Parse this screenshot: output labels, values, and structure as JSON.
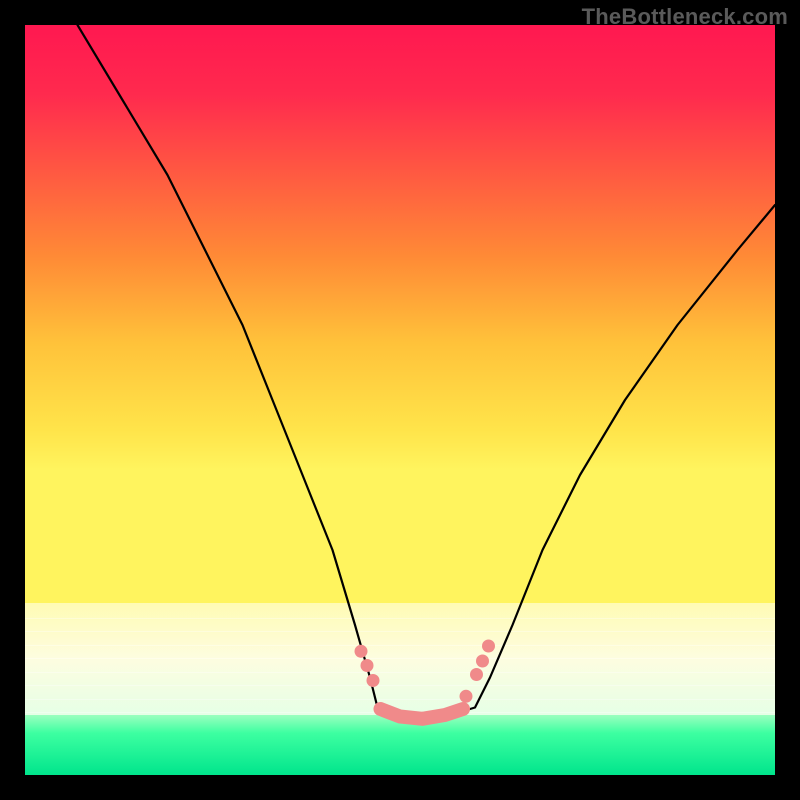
{
  "watermark": "TheBottleneck.com",
  "gradient": {
    "stops": [
      {
        "pos": 0.0,
        "color": "#ff1850"
      },
      {
        "pos": 0.12,
        "color": "#ff2a4e"
      },
      {
        "pos": 0.25,
        "color": "#ff5742"
      },
      {
        "pos": 0.4,
        "color": "#ff8a36"
      },
      {
        "pos": 0.55,
        "color": "#ffc23a"
      },
      {
        "pos": 0.7,
        "color": "#ffe44a"
      },
      {
        "pos": 0.77,
        "color": "#fff45e"
      }
    ]
  },
  "pale_band": {
    "top": 0.77,
    "bottom": 0.92,
    "stops": [
      {
        "pos": 0.0,
        "color": "#fffbb4"
      },
      {
        "pos": 0.5,
        "color": "#fdfde0"
      },
      {
        "pos": 1.0,
        "color": "#e6ffe6"
      }
    ]
  },
  "green_band": {
    "top": 0.92,
    "bottom": 1.0,
    "stops": [
      {
        "pos": 0.0,
        "color": "#9bffbf"
      },
      {
        "pos": 0.3,
        "color": "#3dffa1"
      },
      {
        "pos": 1.0,
        "color": "#00e58c"
      }
    ]
  },
  "curves": {
    "left": [
      [
        0.07,
        0.0
      ],
      [
        0.13,
        0.1
      ],
      [
        0.19,
        0.2
      ],
      [
        0.24,
        0.3
      ],
      [
        0.29,
        0.4
      ],
      [
        0.33,
        0.5
      ],
      [
        0.37,
        0.6
      ],
      [
        0.41,
        0.7
      ],
      [
        0.44,
        0.8
      ],
      [
        0.46,
        0.87
      ],
      [
        0.47,
        0.91
      ]
    ],
    "right": [
      [
        0.6,
        0.91
      ],
      [
        0.62,
        0.87
      ],
      [
        0.65,
        0.8
      ],
      [
        0.69,
        0.7
      ],
      [
        0.74,
        0.6
      ],
      [
        0.8,
        0.5
      ],
      [
        0.87,
        0.4
      ],
      [
        0.95,
        0.3
      ],
      [
        1.0,
        0.24
      ]
    ],
    "bottom": [
      [
        0.47,
        0.91
      ],
      [
        0.5,
        0.925
      ],
      [
        0.55,
        0.925
      ],
      [
        0.6,
        0.91
      ]
    ]
  },
  "salmon": {
    "color": "#f08a8a",
    "left_dots": [
      [
        0.448,
        0.835
      ],
      [
        0.456,
        0.854
      ],
      [
        0.464,
        0.874
      ]
    ],
    "right_dots": [
      [
        0.588,
        0.895
      ],
      [
        0.602,
        0.866
      ],
      [
        0.61,
        0.848
      ],
      [
        0.618,
        0.828
      ]
    ],
    "bottom_band": [
      [
        0.474,
        0.912
      ],
      [
        0.5,
        0.922
      ],
      [
        0.53,
        0.925
      ],
      [
        0.56,
        0.92
      ],
      [
        0.584,
        0.912
      ]
    ]
  },
  "chart_data": {
    "type": "line",
    "title": "",
    "xlabel": "",
    "ylabel": "",
    "series": [
      {
        "name": "bottleneck-curve-left",
        "x": [
          0.07,
          0.13,
          0.19,
          0.24,
          0.29,
          0.33,
          0.37,
          0.41,
          0.44,
          0.46,
          0.47
        ],
        "y": [
          1.0,
          0.9,
          0.8,
          0.7,
          0.6,
          0.5,
          0.4,
          0.3,
          0.2,
          0.13,
          0.09
        ]
      },
      {
        "name": "bottleneck-curve-right",
        "x": [
          0.6,
          0.62,
          0.65,
          0.69,
          0.74,
          0.8,
          0.87,
          0.95,
          1.0
        ],
        "y": [
          0.09,
          0.13,
          0.2,
          0.3,
          0.4,
          0.5,
          0.6,
          0.7,
          0.76
        ]
      },
      {
        "name": "bottleneck-valley",
        "x": [
          0.47,
          0.5,
          0.55,
          0.6
        ],
        "y": [
          0.09,
          0.075,
          0.075,
          0.09
        ]
      }
    ],
    "xlim": [
      0,
      1
    ],
    "ylim": [
      0,
      1
    ]
  }
}
